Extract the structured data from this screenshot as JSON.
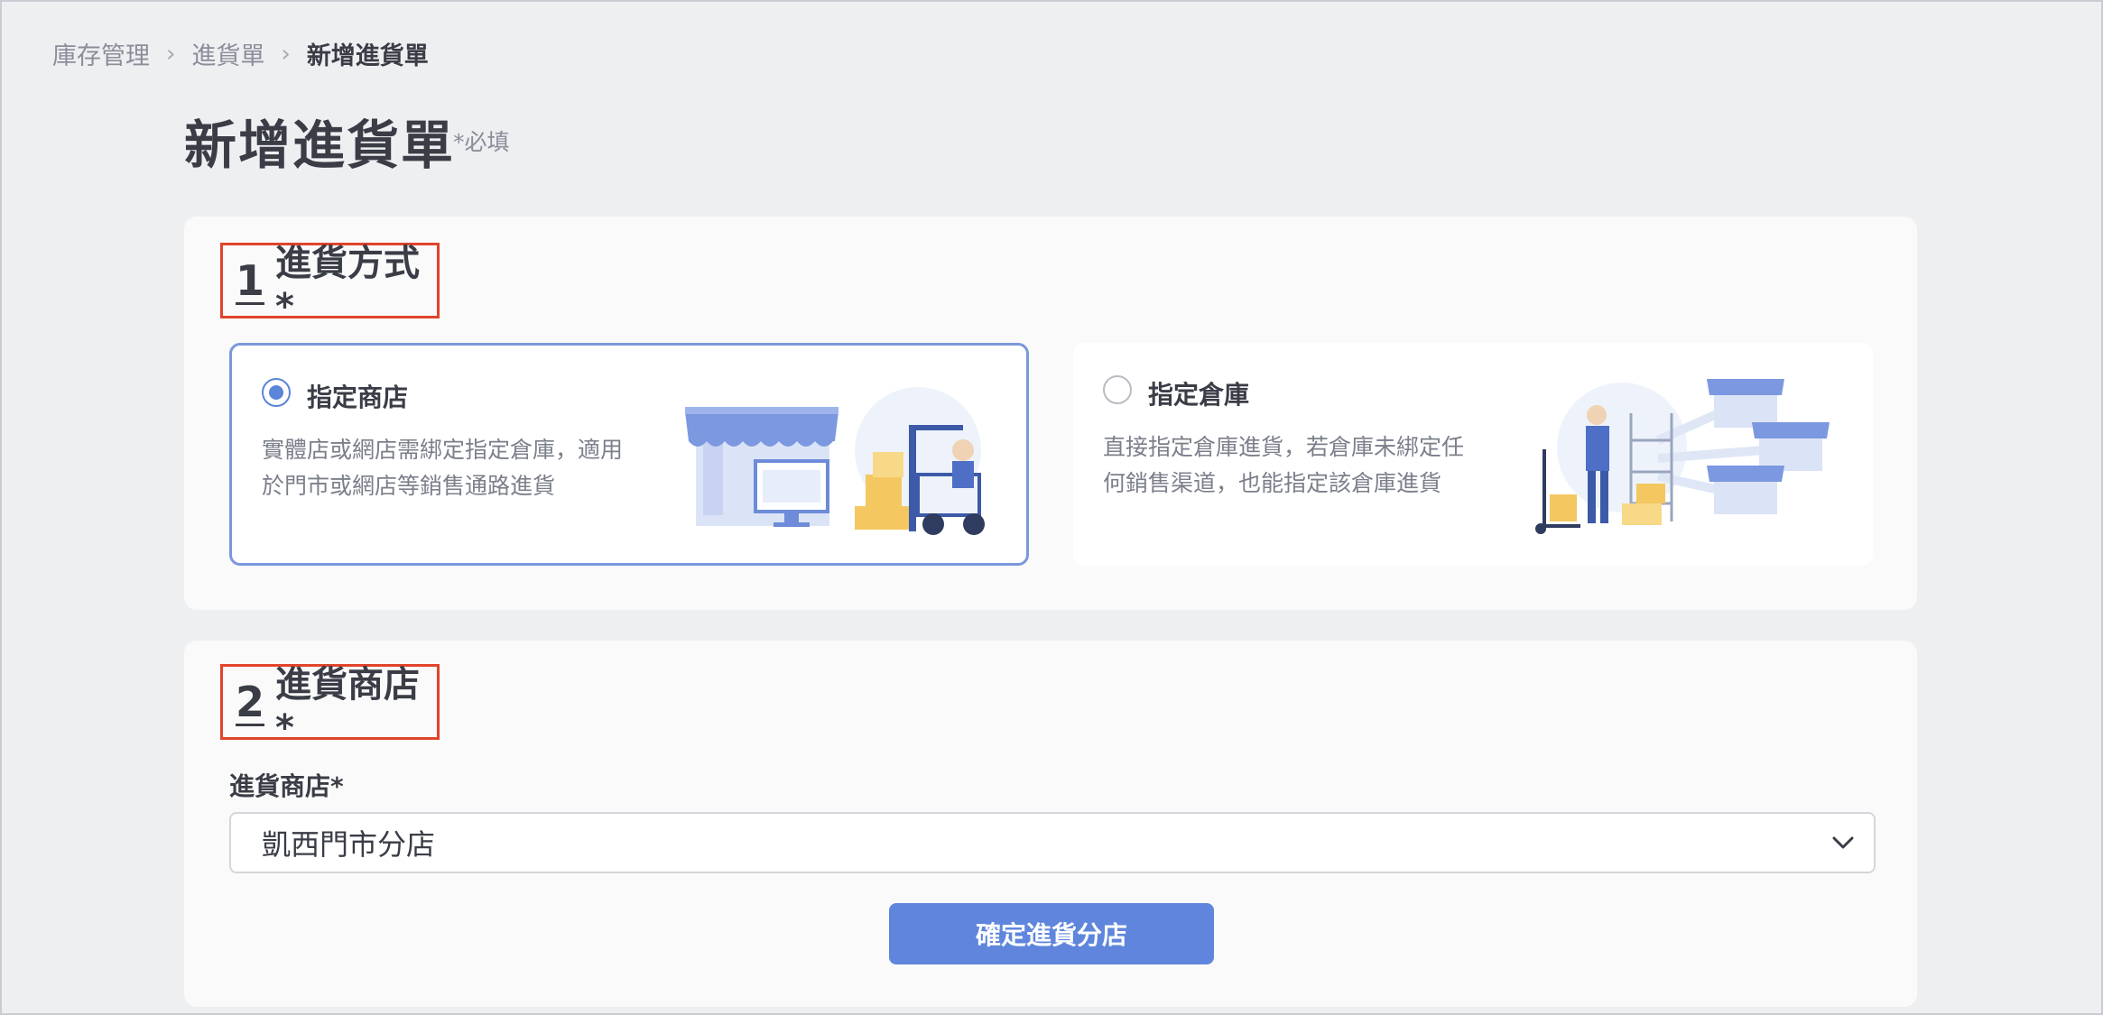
{
  "breadcrumb": [
    "庫存管理",
    "進貨單",
    "新增進貨單"
  ],
  "page": {
    "title": "新增進貨單",
    "required_note": "*必填"
  },
  "section1": {
    "number": "1",
    "title": "進貨方式*",
    "options": [
      {
        "label": "指定商店",
        "description": "實體店或網店需綁定指定倉庫，適用於門市或網店等銷售通路進貨",
        "selected": true,
        "illustration": "storefront-forklift-illustration"
      },
      {
        "label": "指定倉庫",
        "description": "直接指定倉庫進貨，若倉庫未綁定任何銷售渠道，也能指定該倉庫進貨",
        "selected": false,
        "illustration": "warehouse-stores-illustration"
      }
    ]
  },
  "section2": {
    "number": "2",
    "title": "進貨商店*",
    "field_label": "進貨商店*",
    "selected_store": "凱西門市分店",
    "confirm_label": "確定進貨分店"
  },
  "colors": {
    "accent": "#5f86dc",
    "highlight_border": "#e0442b",
    "background": "#eeeff1"
  }
}
